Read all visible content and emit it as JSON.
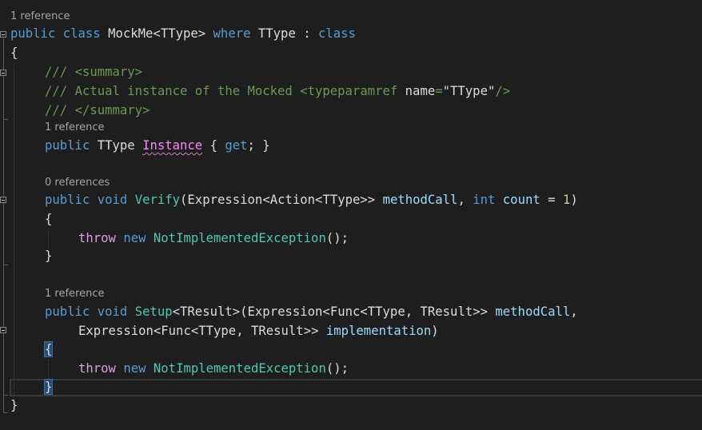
{
  "lens": {
    "class_refs": "1 reference",
    "instance_refs": "1 reference",
    "verify_refs": "0 references",
    "setup_refs": "1 reference"
  },
  "code": {
    "kw_public": "public",
    "kw_class": "class",
    "kw_where": "where",
    "kw_void": "void",
    "kw_get": "get",
    "kw_int": "int",
    "kw_throw": "throw",
    "kw_new": "new",
    "class_name": "MockMe",
    "type_param": "TType",
    "type_param2": "TResult",
    "doc_slashes": "///",
    "doc_summary_open": "<summary>",
    "doc_text_1": "Actual instance of the Mocked",
    "doc_typeparamref_open": "<typeparamref",
    "doc_name_attr": "name",
    "doc_name_value": "\"TType\"",
    "doc_close": "/>",
    "doc_summary_close": "</summary>",
    "prop_instance": "Instance",
    "method_verify": "Verify",
    "method_setup": "Setup",
    "type_expression": "Expression",
    "type_action": "Action",
    "type_func": "Func",
    "type_exception": "NotImplementedException",
    "param_methodcall": "methodCall",
    "param_count": "count",
    "param_implementation": "implementation",
    "num_one": "1"
  },
  "colors": {
    "background": "#1e1e1e",
    "keyword": "#569cd6",
    "type": "#4ec9b0",
    "method": "#dcdcaa",
    "parameter": "#9cdcfe",
    "comment": "#6a9955",
    "control_keyword": "#d8a0df",
    "property_squiggle": "#c586c0"
  }
}
